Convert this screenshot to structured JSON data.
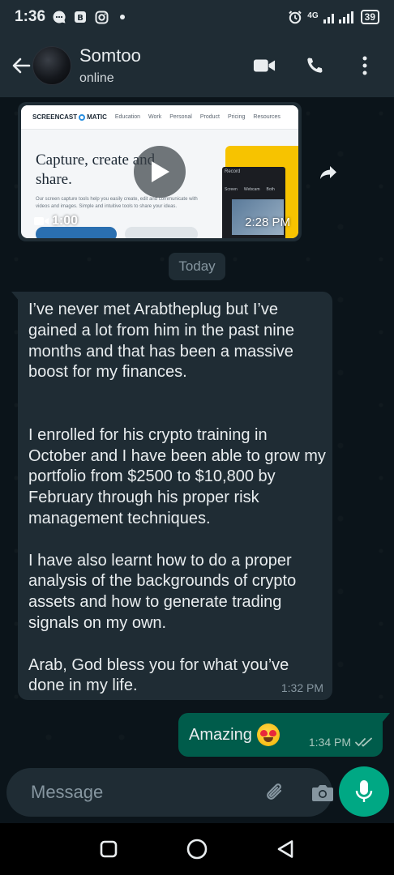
{
  "status_bar": {
    "time": "1:36",
    "network": "4G",
    "battery": "39",
    "icons": [
      "message-bubble-icon",
      "app-b-icon",
      "instagram-icon",
      "dot-icon",
      "alarm-icon",
      "signal-icon",
      "battery-icon"
    ]
  },
  "header": {
    "contact_name": "Somtoo",
    "contact_status": "online",
    "icons": [
      "back-arrow-icon",
      "video-call-icon",
      "voice-call-icon",
      "more-vert-icon"
    ]
  },
  "video_message": {
    "thumbnail": {
      "brand": "SCREENCAST",
      "brand_suffix": "MATIC",
      "nav_items": [
        "Education",
        "Work",
        "Personal",
        "Product",
        "Pricing",
        "Resources"
      ],
      "headline_line1": "Capture, create and",
      "headline_line2": "share.",
      "description": "Our screen capture tools help you easily create, edit and communicate with videos and images. Simple and intuitive tools to share your ideas.",
      "panel_title": "Record",
      "panel_tabs": [
        "Screen",
        "Webcam",
        "Both"
      ]
    },
    "duration": "1:00",
    "time": "2:28 PM"
  },
  "date_chip": "Today",
  "incoming_message": {
    "text": "I’ve never met Arabtheplug but I’ve gained a lot from him in the past nine months and that has been a massive boost for my finances.\n\n\nI enrolled for his crypto training in October and I have been able to grow my portfolio from $2500 to $10,800 by February through his proper risk management techniques.\n\nI have also learnt how to do a proper analysis of the backgrounds of crypto assets and how to generate trading signals on my own.\n\nArab, God bless you for what you’ve done in my life.",
    "time": "1:32 PM"
  },
  "outgoing_message": {
    "text": "Amazing",
    "emoji": "heart-eyes-emoji",
    "time": "1:34 PM",
    "status": "read"
  },
  "input_bar": {
    "placeholder": "Message"
  },
  "colors": {
    "chat_bg": "#0b141a",
    "bar_bg": "#1f2c34",
    "incoming_bubble": "#1f2c34",
    "outgoing_bubble": "#005c4b",
    "accent": "#00a884",
    "read_ticks": "#53bdeb"
  }
}
